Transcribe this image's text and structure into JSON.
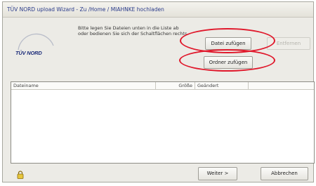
{
  "window": {
    "title": "TÜV NORD upload Wizard - Zu /Home / MIAHNKE hochladen"
  },
  "logo": {
    "text": "TÜV NORD"
  },
  "instructions": {
    "text": "Bitte legen Sie Dateien unten in die Liste ab oder bedienen Sie sich der Schaltflächen rechts."
  },
  "actions": {
    "add_file": "Datei zufügen",
    "remove": "Entfernen",
    "add_folder": "Ordner zufügen"
  },
  "file_table": {
    "columns": [
      "Dateiname",
      "Größe",
      "Geändert"
    ],
    "rows": []
  },
  "footer": {
    "lock_icon": "lock-icon",
    "next": "Weiter >",
    "cancel": "Abbrechen"
  },
  "colors": {
    "highlight_ring": "#e0182b",
    "logo_blue": "#1d2d7a"
  }
}
